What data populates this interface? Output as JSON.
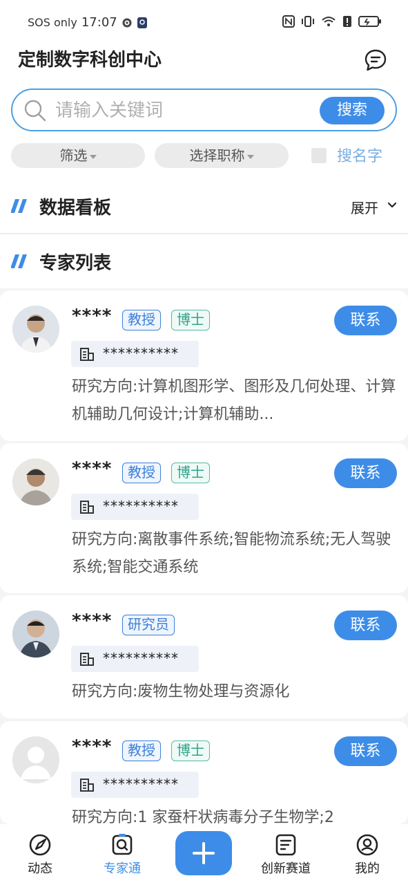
{
  "status_bar": {
    "carrier": "SOS only",
    "time": "17:07"
  },
  "header": {
    "title": "定制数字科创中心",
    "message_icon": "chat-bubble-icon"
  },
  "search": {
    "placeholder": "请输入关键词",
    "button": "搜索"
  },
  "filters": {
    "filter_label": "筛选",
    "title_label": "选择职称",
    "search_name_label": "搜名字"
  },
  "dashboard": {
    "title": "数据看板",
    "expand_label": "展开"
  },
  "experts": {
    "title": "专家列表",
    "items": [
      {
        "name": "****",
        "tags": [
          {
            "text": "教授",
            "color": "blue"
          },
          {
            "text": "博士",
            "color": "green"
          }
        ],
        "contact": "联系",
        "org": "**********",
        "research": "研究方向:计算机图形学、图形及几何处理、计算机辅助几何设计;计算机辅助..."
      },
      {
        "name": "****",
        "tags": [
          {
            "text": "教授",
            "color": "blue"
          },
          {
            "text": "博士",
            "color": "green"
          }
        ],
        "contact": "联系",
        "org": "**********",
        "research": "研究方向:离散事件系统;智能物流系统;无人驾驶系统;智能交通系统"
      },
      {
        "name": "****",
        "tags": [
          {
            "text": "研究员",
            "color": "blue"
          }
        ],
        "contact": "联系",
        "org": "**********",
        "research": "研究方向:废物生物处理与资源化"
      },
      {
        "name": "****",
        "tags": [
          {
            "text": "教授",
            "color": "blue"
          },
          {
            "text": "博士",
            "color": "green"
          }
        ],
        "contact": "联系",
        "org": "**********",
        "research": "研究方向:1 家蚕杆状病毒分子生物学;2"
      }
    ]
  },
  "bottom_nav": {
    "items": [
      {
        "label": "动态",
        "icon": "compass-icon"
      },
      {
        "label": "专家通",
        "icon": "expert-search-icon",
        "active": true
      },
      {
        "label": "",
        "icon": "plus-icon"
      },
      {
        "label": "创新赛道",
        "icon": "document-icon"
      },
      {
        "label": "我的",
        "icon": "profile-icon"
      }
    ]
  },
  "colors": {
    "accent": "#3d8de8",
    "tag_blue": "#3c7fd8",
    "tag_green": "#2fa38a"
  }
}
